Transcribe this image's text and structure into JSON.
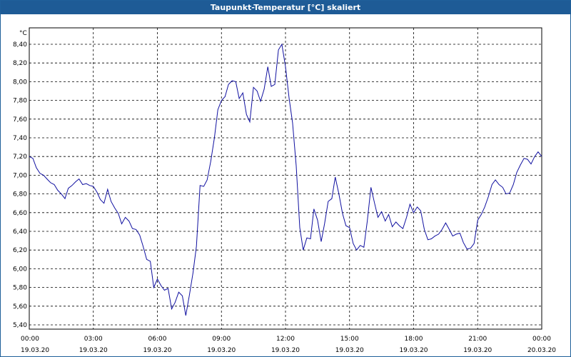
{
  "window": {
    "title": "Taupunkt-Temperatur [°C] skaliert"
  },
  "colors": {
    "title_bar": "#1e5b96",
    "series": "#1010a0",
    "grid": "#000000"
  },
  "chart_data": {
    "type": "line",
    "title": "Taupunkt-Temperatur [°C] skaliert",
    "ylabel": "°C",
    "xlabel": "",
    "grid": true,
    "grid_style": "dashed",
    "ylim": [
      5.4,
      8.5
    ],
    "xlim_hours": [
      0,
      24
    ],
    "y_ticks": [
      "8,40",
      "8,20",
      "8,00",
      "7,80",
      "7,60",
      "7,40",
      "7,20",
      "7,00",
      "6,80",
      "6,60",
      "6,40",
      "6,20",
      "6,00",
      "5,80",
      "5,60",
      "5,40"
    ],
    "y_tick_values": [
      8.4,
      8.2,
      8.0,
      7.8,
      7.6,
      7.4,
      7.2,
      7.0,
      6.8,
      6.6,
      6.4,
      6.2,
      6.0,
      5.8,
      5.6,
      5.4
    ],
    "x_ticks": [
      {
        "time": "00:00",
        "date": "19.03.20"
      },
      {
        "time": "03:00",
        "date": "19.03.20"
      },
      {
        "time": "06:00",
        "date": "19.03.20"
      },
      {
        "time": "09:00",
        "date": "19.03.20"
      },
      {
        "time": "12:00",
        "date": "19.03.20"
      },
      {
        "time": "15:00",
        "date": "19.03.20"
      },
      {
        "time": "18:00",
        "date": "19.03.20"
      },
      {
        "time": "21:00",
        "date": "19.03.20"
      },
      {
        "time": "00:00",
        "date": "20.03.20"
      }
    ],
    "series": [
      {
        "x_hours": [
          0.0,
          0.17,
          0.33,
          0.5,
          0.67,
          0.83,
          1.0,
          1.17,
          1.33,
          1.5,
          1.67,
          1.83,
          2.0,
          2.17,
          2.33,
          2.5,
          2.67,
          2.83,
          3.0,
          3.17,
          3.33,
          3.5,
          3.67,
          3.83,
          4.0,
          4.17,
          4.33,
          4.5,
          4.67,
          4.83,
          5.0,
          5.17,
          5.33,
          5.5,
          5.67,
          5.83,
          6.0,
          6.17,
          6.33,
          6.5,
          6.67,
          6.83,
          7.0,
          7.17,
          7.33,
          7.5,
          7.67,
          7.83,
          8.0,
          8.17,
          8.33,
          8.5,
          8.67,
          8.83,
          9.0,
          9.17,
          9.33,
          9.5,
          9.67,
          9.83,
          10.0,
          10.17,
          10.33,
          10.5,
          10.67,
          10.83,
          11.0,
          11.17,
          11.33,
          11.5,
          11.67,
          11.83,
          12.0,
          12.17,
          12.33,
          12.5,
          12.67,
          12.83,
          13.0,
          13.17,
          13.33,
          13.5,
          13.67,
          13.83,
          14.0,
          14.17,
          14.33,
          14.5,
          14.67,
          14.83,
          15.0,
          15.17,
          15.33,
          15.5,
          15.67,
          15.83,
          16.0,
          16.17,
          16.33,
          16.5,
          16.67,
          16.83,
          17.0,
          17.17,
          17.33,
          17.5,
          17.67,
          17.83,
          18.0,
          18.17,
          18.33,
          18.5,
          18.67,
          18.83,
          19.0,
          19.17,
          19.33,
          19.5,
          19.67,
          19.83,
          20.0,
          20.17,
          20.33,
          20.5,
          20.67,
          20.83,
          21.0,
          21.17,
          21.33,
          21.5,
          21.67,
          21.83,
          22.0,
          22.17,
          22.33,
          22.5,
          22.67,
          22.83,
          23.0,
          23.17,
          23.33,
          23.5,
          23.67,
          23.83,
          24.0
        ],
        "y": [
          7.2,
          7.18,
          7.08,
          7.02,
          7.0,
          6.96,
          6.92,
          6.9,
          6.84,
          6.8,
          6.75,
          6.86,
          6.89,
          6.93,
          6.96,
          6.9,
          6.91,
          6.89,
          6.88,
          6.82,
          6.74,
          6.7,
          6.85,
          6.72,
          6.65,
          6.59,
          6.48,
          6.55,
          6.51,
          6.43,
          6.42,
          6.36,
          6.24,
          6.1,
          6.08,
          5.8,
          5.89,
          5.82,
          5.77,
          5.79,
          5.57,
          5.64,
          5.75,
          5.71,
          5.5,
          5.72,
          5.96,
          6.24,
          6.89,
          6.88,
          6.95,
          7.15,
          7.4,
          7.7,
          7.8,
          7.84,
          7.97,
          8.01,
          8.0,
          7.82,
          7.88,
          7.65,
          7.57,
          7.94,
          7.9,
          7.79,
          7.92,
          8.16,
          7.95,
          7.97,
          8.34,
          8.4,
          8.16,
          7.82,
          7.56,
          7.1,
          6.44,
          6.2,
          6.33,
          6.32,
          6.64,
          6.52,
          6.29,
          6.48,
          6.72,
          6.75,
          6.98,
          6.8,
          6.59,
          6.46,
          6.44,
          6.27,
          6.2,
          6.25,
          6.23,
          6.51,
          6.87,
          6.7,
          6.55,
          6.61,
          6.51,
          6.58,
          6.45,
          6.5,
          6.46,
          6.43,
          6.55,
          6.69,
          6.6,
          6.66,
          6.62,
          6.42,
          6.31,
          6.32,
          6.35,
          6.37,
          6.42,
          6.49,
          6.42,
          6.35,
          6.37,
          6.38,
          6.28,
          6.21,
          6.22,
          6.27,
          6.52,
          6.58,
          6.66,
          6.77,
          6.9,
          6.95,
          6.9,
          6.87,
          6.8,
          6.81,
          6.9,
          7.03,
          7.11,
          7.18,
          7.17,
          7.12,
          7.2,
          7.25,
          7.2,
          7.19
        ]
      }
    ]
  }
}
